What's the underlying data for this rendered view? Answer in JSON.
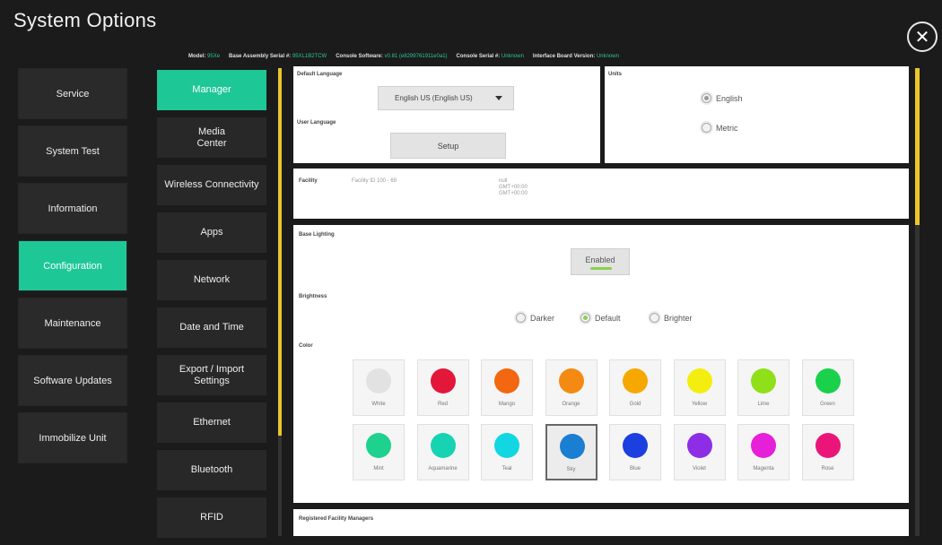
{
  "window": {
    "title": "System Options",
    "close_symbol": "✕"
  },
  "infobar": [
    {
      "label": "Model:",
      "value": "95Xe"
    },
    {
      "label": "Base Assembly Serial #:",
      "value": "95XL1B2TCW"
    },
    {
      "label": "Console Software:",
      "value": "v0.81 (e8299761911e0a1)"
    },
    {
      "label": "Console Serial #:",
      "value": "Unknown"
    },
    {
      "label": "Interface Board Version:",
      "value": "Unknown"
    }
  ],
  "main_nav": [
    "Service",
    "System Test",
    "Information",
    "Configuration",
    "Maintenance",
    "Software Updates",
    "Immobilize Unit"
  ],
  "main_nav_active": "Configuration",
  "sub_nav": [
    [
      "Manager"
    ],
    [
      "Media",
      "Center"
    ],
    [
      "Wireless Connectivity"
    ],
    [
      "Apps"
    ],
    [
      "Network"
    ],
    [
      "Date and Time"
    ],
    [
      "Export / Import",
      "Settings"
    ],
    [
      "Ethernet"
    ],
    [
      "Bluetooth"
    ],
    [
      "RFID"
    ]
  ],
  "sub_nav_active": "Manager",
  "language": {
    "default_label": "Default Language",
    "default_value": "English US (English US)",
    "user_label": "User Language",
    "setup_button": "Setup"
  },
  "units": {
    "label": "Units",
    "options": [
      {
        "label": "English",
        "selected": true
      },
      {
        "label": "Metric",
        "selected": false
      }
    ]
  },
  "facility": {
    "label": "Facility",
    "id_text": "Facility ID 100 - 69",
    "lines": [
      "null",
      "GMT+00:00",
      "GMT+00:00"
    ]
  },
  "lighting": {
    "label": "Base Lighting",
    "toggle_label": "Enabled",
    "brightness_label": "Brightness",
    "brightness_options": [
      {
        "label": "Darker",
        "selected": false
      },
      {
        "label": "Default",
        "selected": true
      },
      {
        "label": "Brighter",
        "selected": false
      }
    ],
    "color_label": "Color",
    "colors": [
      {
        "name": "White",
        "hex": "#e2e2e2"
      },
      {
        "name": "Red",
        "hex": "#e3173a"
      },
      {
        "name": "Mango",
        "hex": "#f2670f"
      },
      {
        "name": "Orange",
        "hex": "#f48a12"
      },
      {
        "name": "Gold",
        "hex": "#f6a800"
      },
      {
        "name": "Yellow",
        "hex": "#f3ee10"
      },
      {
        "name": "Lime",
        "hex": "#8fe018"
      },
      {
        "name": "Green",
        "hex": "#1ad14b"
      },
      {
        "name": "Mint",
        "hex": "#1fd18e"
      },
      {
        "name": "Aquamarine",
        "hex": "#17d3b2"
      },
      {
        "name": "Teal",
        "hex": "#13d6e3"
      },
      {
        "name": "Sky",
        "hex": "#1a7ed2"
      },
      {
        "name": "Blue",
        "hex": "#1c3fe0"
      },
      {
        "name": "Violet",
        "hex": "#8d2ee6"
      },
      {
        "name": "Magenta",
        "hex": "#e620d8"
      },
      {
        "name": "Rose",
        "hex": "#eb157a"
      }
    ],
    "selected_color": "Sky"
  },
  "managers": {
    "label": "Registered Facility Managers"
  },
  "colors": {
    "accent": "#1ec796",
    "scroll": "#ecc62a",
    "background": "#1b1b1b"
  }
}
